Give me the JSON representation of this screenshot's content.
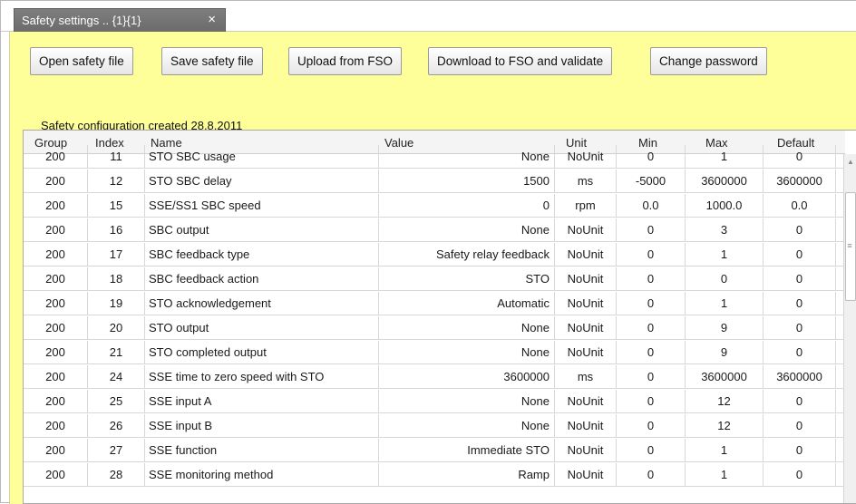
{
  "tab": {
    "title": "Safety settings .. {1}{1}",
    "close": "×"
  },
  "toolbar": {
    "open": "Open safety file",
    "save": "Save safety file",
    "upload": "Upload from FSO",
    "download": "Download to FSO and validate",
    "password": "Change password"
  },
  "created_text": "Safety configuration created 28.8.2011",
  "columns": {
    "group": "Group",
    "index": "Index",
    "name": "Name",
    "value": "Value",
    "unit": "Unit",
    "min": "Min",
    "max": "Max",
    "default": "Default"
  },
  "rows": [
    {
      "group": "200",
      "index": "11",
      "name": "STO SBC usage",
      "value": "None",
      "unit": "NoUnit",
      "min": "0",
      "max": "1",
      "default": "0"
    },
    {
      "group": "200",
      "index": "12",
      "name": "STO SBC delay",
      "value": "1500",
      "unit": "ms",
      "min": "-5000",
      "max": "3600000",
      "default": "3600000"
    },
    {
      "group": "200",
      "index": "15",
      "name": "SSE/SS1 SBC speed",
      "value": "0",
      "unit": "rpm",
      "min": "0.0",
      "max": "1000.0",
      "default": "0.0"
    },
    {
      "group": "200",
      "index": "16",
      "name": "SBC output",
      "value": "None",
      "unit": "NoUnit",
      "min": "0",
      "max": "3",
      "default": "0"
    },
    {
      "group": "200",
      "index": "17",
      "name": "SBC feedback type",
      "value": "Safety relay feedback",
      "unit": "NoUnit",
      "min": "0",
      "max": "1",
      "default": "0"
    },
    {
      "group": "200",
      "index": "18",
      "name": "SBC feedback action",
      "value": "STO",
      "unit": "NoUnit",
      "min": "0",
      "max": "0",
      "default": "0"
    },
    {
      "group": "200",
      "index": "19",
      "name": "STO acknowledgement",
      "value": "Automatic",
      "unit": "NoUnit",
      "min": "0",
      "max": "1",
      "default": "0"
    },
    {
      "group": "200",
      "index": "20",
      "name": "STO output",
      "value": "None",
      "unit": "NoUnit",
      "min": "0",
      "max": "9",
      "default": "0"
    },
    {
      "group": "200",
      "index": "21",
      "name": "STO completed output",
      "value": "None",
      "unit": "NoUnit",
      "min": "0",
      "max": "9",
      "default": "0"
    },
    {
      "group": "200",
      "index": "24",
      "name": "SSE time to zero speed with STO",
      "value": "3600000",
      "unit": "ms",
      "min": "0",
      "max": "3600000",
      "default": "3600000"
    },
    {
      "group": "200",
      "index": "25",
      "name": "SSE input A",
      "value": "None",
      "unit": "NoUnit",
      "min": "0",
      "max": "12",
      "default": "0"
    },
    {
      "group": "200",
      "index": "26",
      "name": "SSE input B",
      "value": "None",
      "unit": "NoUnit",
      "min": "0",
      "max": "12",
      "default": "0"
    },
    {
      "group": "200",
      "index": "27",
      "name": "SSE function",
      "value": "Immediate STO",
      "unit": "NoUnit",
      "min": "0",
      "max": "1",
      "default": "0"
    },
    {
      "group": "200",
      "index": "28",
      "name": "SSE monitoring method",
      "value": "Ramp",
      "unit": "NoUnit",
      "min": "0",
      "max": "1",
      "default": "0"
    }
  ]
}
